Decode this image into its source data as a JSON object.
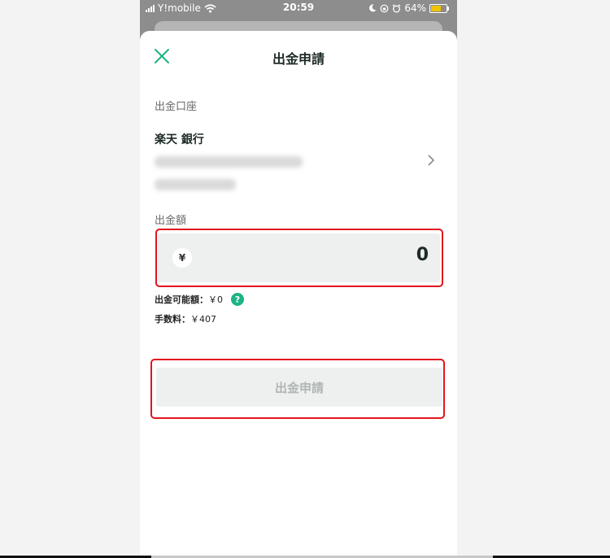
{
  "status_bar": {
    "carrier": "Y!mobile",
    "time": "20:59",
    "battery": "64%",
    "battery_level": 0.64,
    "icons": [
      "signal-icon",
      "wifi-icon",
      "moon-icon",
      "orientation-lock-icon",
      "alarm-icon",
      "battery-icon"
    ]
  },
  "sheet": {
    "title": "出金申請",
    "close_icon": "close-icon"
  },
  "account": {
    "section_label": "出金口座",
    "bank_name": "楽天 銀行",
    "chevron_icon": "chevron-right-icon"
  },
  "amount": {
    "section_label": "出金額",
    "currency_symbol": "¥",
    "value": "0"
  },
  "info": {
    "available_label": "出金可能額：",
    "available_value": "￥0",
    "fee_label": "手数料：",
    "fee_value": "￥407",
    "help_symbol": "?"
  },
  "submit": {
    "label": "出金申請"
  },
  "colors": {
    "accent_green": "#1db385",
    "highlight_red": "#e3141f",
    "input_bg": "#eef0ef",
    "disabled_text": "#b0b6b3"
  }
}
